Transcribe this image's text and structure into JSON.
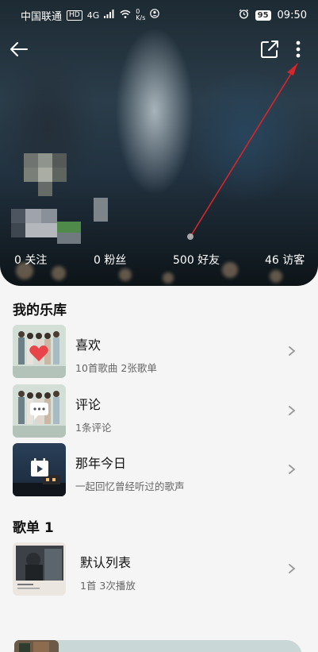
{
  "status_bar": {
    "carrier": "中国联通",
    "hd_badge": "HD",
    "network": "4G",
    "speed_value": "0",
    "speed_unit": "K/s",
    "battery": "95",
    "time": "09:50"
  },
  "profile_stats": [
    {
      "label": "0 关注"
    },
    {
      "label": "0 粉丝"
    },
    {
      "label": "500 好友"
    },
    {
      "label": "46 访客"
    }
  ],
  "library": {
    "title": "我的乐库",
    "items": [
      {
        "title": "喜欢",
        "subtitle": "10首歌曲 2张歌单"
      },
      {
        "title": "评论",
        "subtitle": "1条评论"
      },
      {
        "title": "那年今日",
        "subtitle": "一起回忆曾经听过的歌声"
      }
    ]
  },
  "playlists": {
    "title": "歌单 1",
    "items": [
      {
        "title": "默认列表",
        "subtitle": "1首 3次播放"
      }
    ]
  },
  "colors": {
    "annotation_arrow": "#d6262b",
    "background": "#f5f5f5",
    "chevron": "#9a9a9a"
  },
  "icons": {
    "back": "arrow-left",
    "share": "share-external",
    "more": "vertical-dots"
  }
}
